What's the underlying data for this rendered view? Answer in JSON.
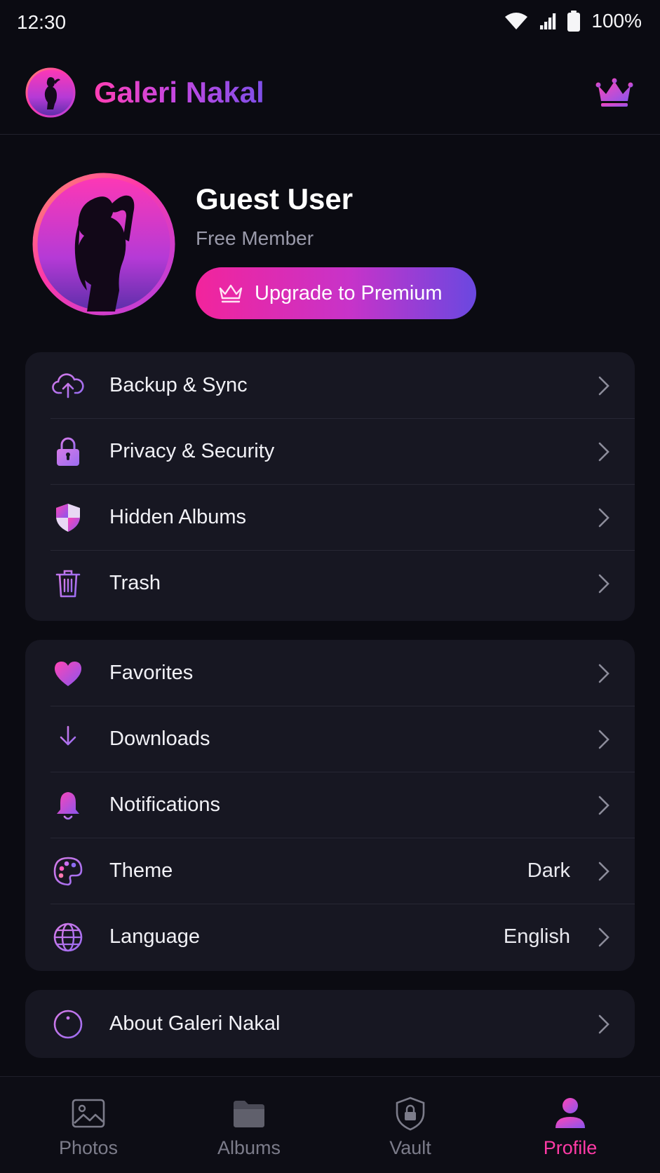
{
  "status_bar": {
    "time": "12:30",
    "battery": "100%"
  },
  "header": {
    "app_title": "Galeri Nakal",
    "premium_icon": "crown-icon"
  },
  "profile": {
    "name": "Guest User",
    "tier": "Free Member",
    "upgrade_label": "Upgrade to Premium"
  },
  "settings_group_1": [
    {
      "label": "Backup & Sync",
      "icon": "cloud-upload-icon"
    },
    {
      "label": "Privacy & Security",
      "icon": "lock-icon"
    },
    {
      "label": "Hidden Albums",
      "icon": "shield-icon"
    },
    {
      "label": "Trash",
      "icon": "trash-icon"
    }
  ],
  "settings_group_2": [
    {
      "label": "Favorites",
      "icon": "heart-icon"
    },
    {
      "label": "Downloads",
      "icon": "download-icon"
    },
    {
      "label": "Notifications",
      "icon": "bell-icon"
    },
    {
      "label": "Theme",
      "icon": "palette-icon",
      "value": "Dark"
    },
    {
      "label": "Language",
      "icon": "globe-icon",
      "value": "English"
    }
  ],
  "settings_group_3": [
    {
      "label": "About Galeri Nakal",
      "icon": "info-icon"
    }
  ],
  "bottom_nav": [
    {
      "label": "Photos",
      "icon": "image-icon"
    },
    {
      "label": "Albums",
      "icon": "folder-icon"
    },
    {
      "label": "Vault",
      "icon": "vault-lock-icon"
    },
    {
      "label": "Profile",
      "icon": "person-icon",
      "active": true
    }
  ],
  "colors": {
    "accent_pink": "#ff3aa6",
    "accent_purple": "#7e4fe8",
    "background": "#0b0b12",
    "card": "#171722"
  }
}
